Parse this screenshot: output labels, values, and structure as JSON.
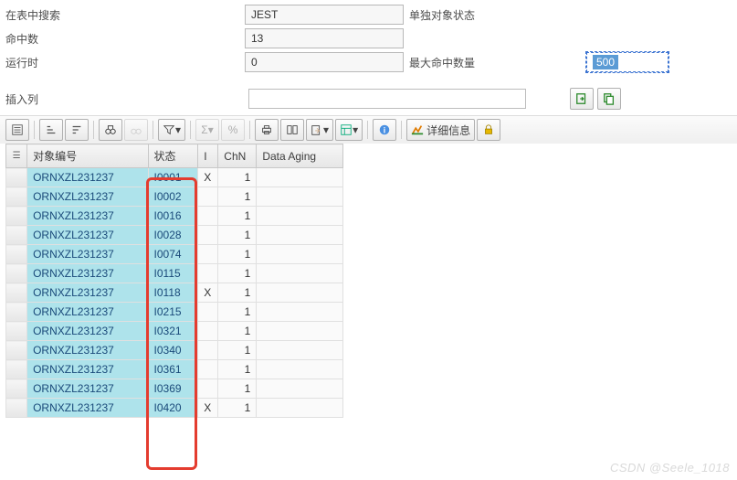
{
  "form": {
    "search_label": "在表中搜索",
    "search_value": "JEST",
    "search_desc": "单独对象状态",
    "hits_label": "命中数",
    "hits_value": "13",
    "runtime_label": "运行时",
    "runtime_value": "0",
    "max_hits_label": "最大命中数量",
    "max_hits_value": "500"
  },
  "insert": {
    "label": "插入列",
    "value": ""
  },
  "btn": {
    "export": "⇲",
    "duplicate": "⿻",
    "detail": "详细信息"
  },
  "columns": {
    "marker": "",
    "objnr": "对象编号",
    "status": "状态",
    "i": "I",
    "chn": "ChN",
    "data_aging": "Data Aging"
  },
  "rows": [
    {
      "objnr": "ORNXZL231237",
      "status": "I0001",
      "i": "X",
      "chn": "1",
      "da": ""
    },
    {
      "objnr": "ORNXZL231237",
      "status": "I0002",
      "i": "",
      "chn": "1",
      "da": ""
    },
    {
      "objnr": "ORNXZL231237",
      "status": "I0016",
      "i": "",
      "chn": "1",
      "da": ""
    },
    {
      "objnr": "ORNXZL231237",
      "status": "I0028",
      "i": "",
      "chn": "1",
      "da": ""
    },
    {
      "objnr": "ORNXZL231237",
      "status": "I0074",
      "i": "",
      "chn": "1",
      "da": ""
    },
    {
      "objnr": "ORNXZL231237",
      "status": "I0115",
      "i": "",
      "chn": "1",
      "da": ""
    },
    {
      "objnr": "ORNXZL231237",
      "status": "I0118",
      "i": "X",
      "chn": "1",
      "da": ""
    },
    {
      "objnr": "ORNXZL231237",
      "status": "I0215",
      "i": "",
      "chn": "1",
      "da": ""
    },
    {
      "objnr": "ORNXZL231237",
      "status": "I0321",
      "i": "",
      "chn": "1",
      "da": ""
    },
    {
      "objnr": "ORNXZL231237",
      "status": "I0340",
      "i": "",
      "chn": "1",
      "da": ""
    },
    {
      "objnr": "ORNXZL231237",
      "status": "I0361",
      "i": "",
      "chn": "1",
      "da": ""
    },
    {
      "objnr": "ORNXZL231237",
      "status": "I0369",
      "i": "",
      "chn": "1",
      "da": ""
    },
    {
      "objnr": "ORNXZL231237",
      "status": "I0420",
      "i": "X",
      "chn": "1",
      "da": ""
    }
  ],
  "watermark": "CSDN @Seele_1018"
}
